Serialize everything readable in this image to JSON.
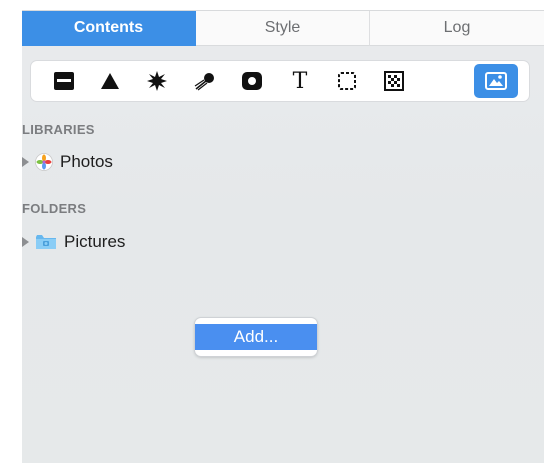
{
  "tabs": [
    {
      "label": "Contents",
      "active": true
    },
    {
      "label": "Style",
      "active": false
    },
    {
      "label": "Log",
      "active": false
    }
  ],
  "toolbar": {
    "tools": [
      {
        "icon": "print-icon",
        "selected": false
      },
      {
        "icon": "triangle-icon",
        "selected": false
      },
      {
        "icon": "burst-icon",
        "selected": false
      },
      {
        "icon": "comet-icon",
        "selected": false
      },
      {
        "icon": "record-icon",
        "selected": false
      },
      {
        "icon": "text-icon",
        "glyph": "T",
        "selected": false
      },
      {
        "icon": "selection-icon",
        "selected": false
      },
      {
        "icon": "pattern-icon",
        "selected": false
      },
      {
        "icon": "image-icon",
        "selected": true
      }
    ]
  },
  "sidebar": {
    "libraries_header": "LIBRARIES",
    "libraries": [
      {
        "label": "Photos",
        "icon": "photos-app-icon"
      }
    ],
    "folders_header": "FOLDERS",
    "folders": [
      {
        "label": "Pictures",
        "icon": "pictures-folder-icon"
      }
    ]
  },
  "add_button": {
    "label": "Add..."
  },
  "colors": {
    "accent": "#3c8fe6",
    "panel_bg": "#e7eaec",
    "header_text": "#7b7d80"
  }
}
